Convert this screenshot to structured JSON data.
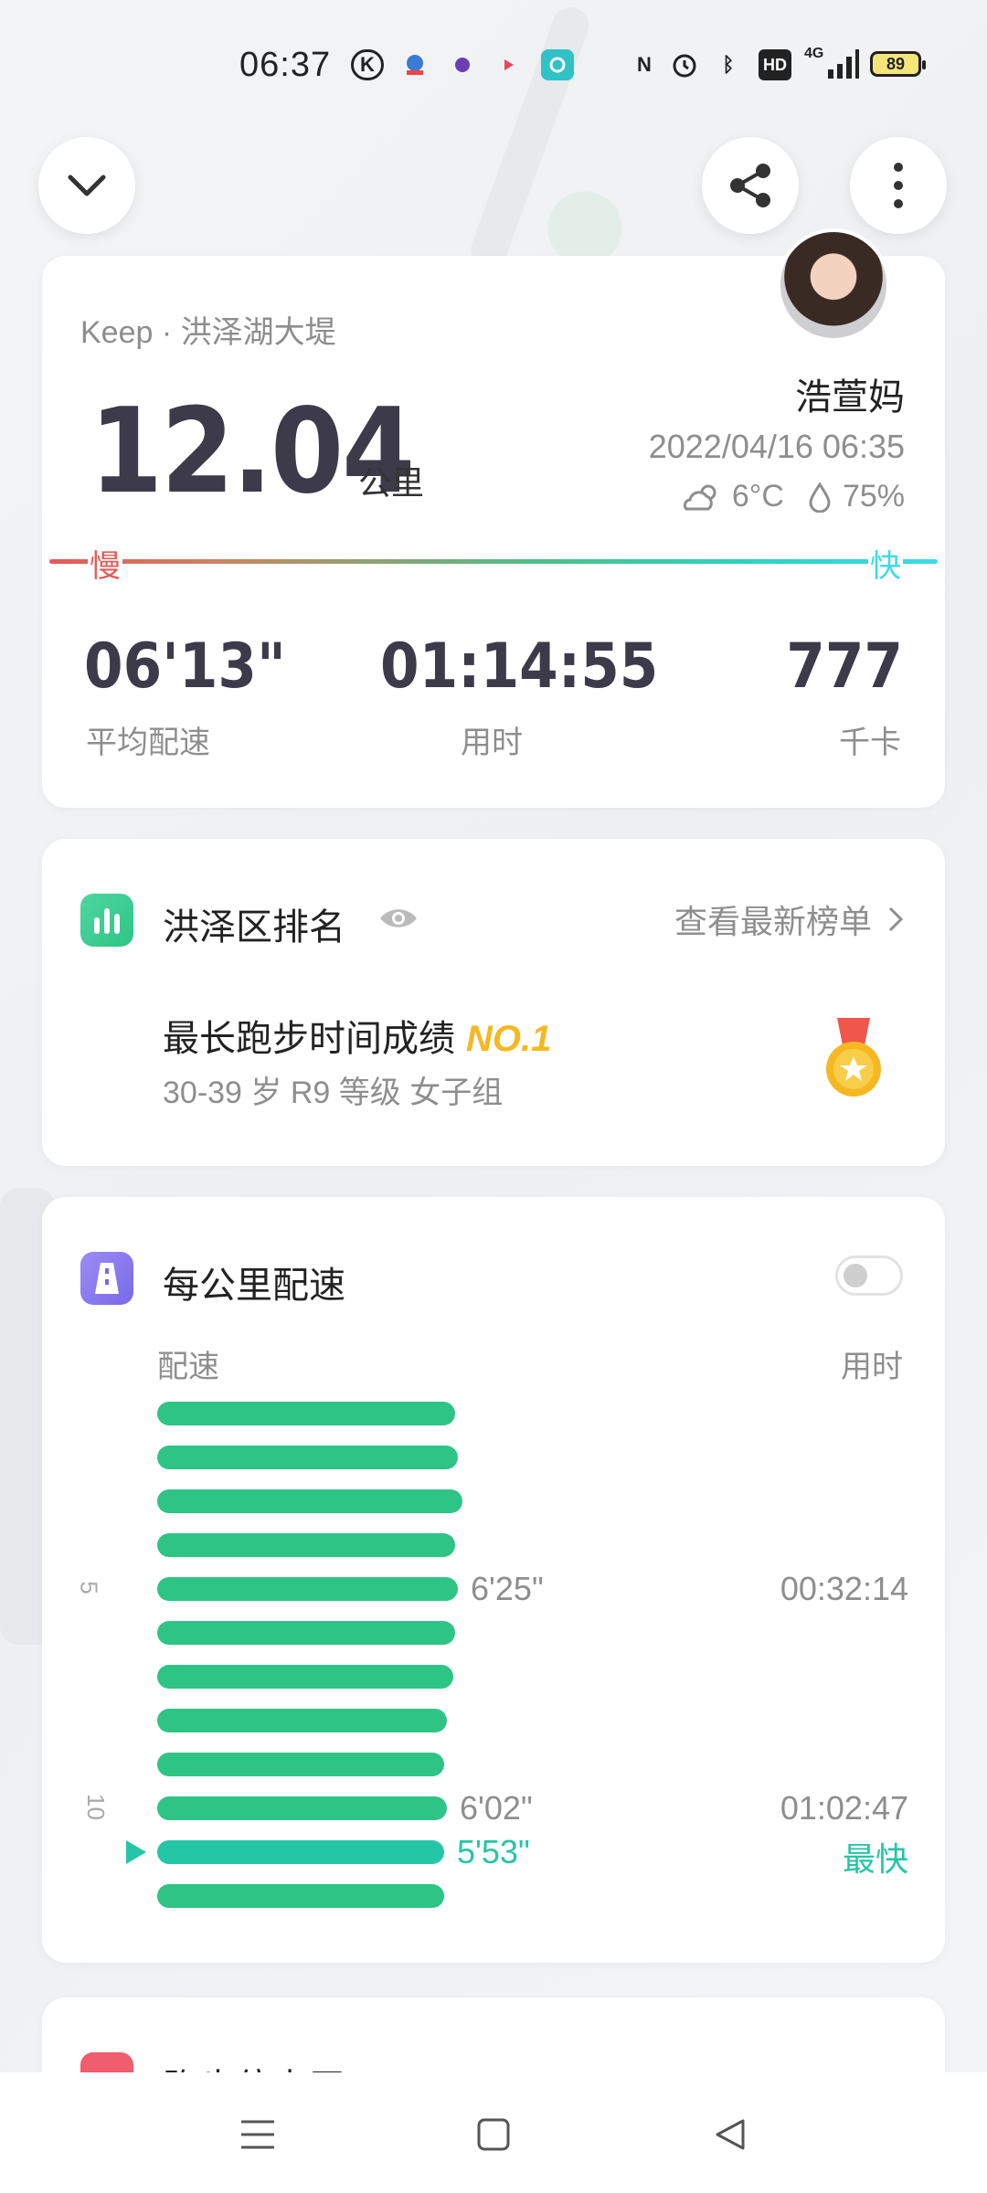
{
  "status_bar": {
    "time": "06:37",
    "battery": "89",
    "network": "4G",
    "hd_label": "HD",
    "icons": [
      "k-app-icon",
      "app-icon-2",
      "app-icon-3",
      "app-icon-4",
      "app-icon-5",
      "nfc-icon",
      "alarm-icon",
      "bluetooth-icon",
      "hd-icon",
      "signal-icon",
      "battery-icon"
    ]
  },
  "top_actions": {
    "collapse_icon": "chevron-down-icon",
    "share_icon": "share-icon",
    "more_icon": "more-vertical-icon"
  },
  "summary": {
    "source": "Keep · 洪泽湖大堤",
    "distance": "12.04",
    "distance_unit": "公里",
    "username": "浩萱妈",
    "datetime": "2022/04/16 06:35",
    "temperature": "6°C",
    "humidity": "75%",
    "slow_label": "慢",
    "fast_label": "快",
    "stats": [
      {
        "value": "06'13\"",
        "label": "平均配速"
      },
      {
        "value": "01:14:55",
        "label": "用时"
      },
      {
        "value": "777",
        "label": "千卡"
      }
    ]
  },
  "ranking": {
    "title": "洪泽区排名",
    "link": "查看最新榜单",
    "achievement": "最长跑步时间成绩",
    "rank": "NO.1",
    "group": "30-39 岁 R9 等级 女子组"
  },
  "pace": {
    "title": "每公里配速",
    "col_pace": "配速",
    "col_time": "用时",
    "toggle_on": false,
    "km_ticks": [
      {
        "km": "5",
        "row": 4
      },
      {
        "km": "10",
        "row": 9
      }
    ],
    "bars": [
      {
        "km": 1,
        "fill": 0.652
      },
      {
        "km": 2,
        "fill": 0.658
      },
      {
        "km": 3,
        "fill": 0.667
      },
      {
        "km": 4,
        "fill": 0.652
      },
      {
        "km": 5,
        "fill": 0.658,
        "pace": "6'25\"",
        "time": "00:32:14"
      },
      {
        "km": 6,
        "fill": 0.652
      },
      {
        "km": 7,
        "fill": 0.648
      },
      {
        "km": 8,
        "fill": 0.633
      },
      {
        "km": 9,
        "fill": 0.627
      },
      {
        "km": 10,
        "fill": 0.633,
        "pace": "6'02\"",
        "time": "01:02:47"
      },
      {
        "km": 11,
        "fill": 0.627,
        "pace": "5'53\"",
        "time": "最快",
        "best": true
      },
      {
        "km": 12,
        "fill": 0.627
      }
    ],
    "colors": {
      "bar": "#2ec485",
      "best": "#25c6a5"
    }
  },
  "next_section": {
    "title": "跑步倍卡平"
  },
  "nav": {
    "menu_icon": "menu-icon",
    "home_icon": "home-square-icon",
    "back_icon": "back-triangle-icon"
  }
}
